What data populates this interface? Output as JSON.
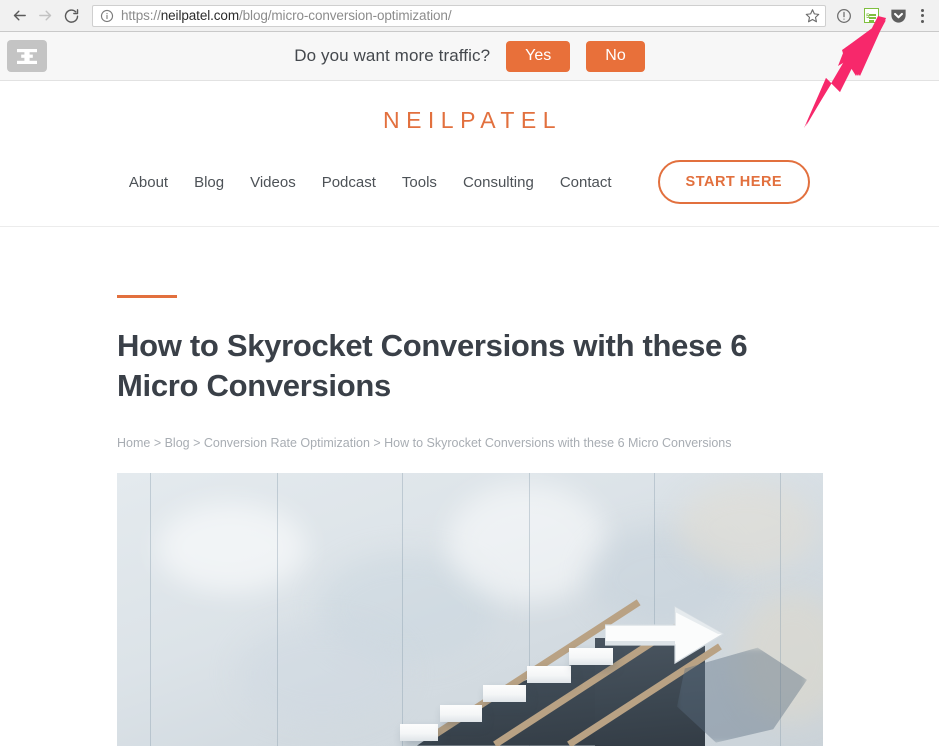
{
  "browser": {
    "back_icon": "back-arrow-icon",
    "forward_icon": "forward-arrow-icon",
    "reload_icon": "reload-icon",
    "security_icon": "info-circle-icon",
    "url_full": "https://neilpatel.com/blog/micro-conversion-optimization/",
    "url_prefix": "https://",
    "url_host": "neilpatel.com",
    "url_path": "/blog/micro-conversion-optimization/",
    "bookmark_icon": "star-icon",
    "extensions": [
      {
        "name": "reader-extension-icon",
        "label": "Reader"
      },
      {
        "name": "pocket-extension-icon",
        "label": "Pocket"
      }
    ],
    "menu_icon": "three-dot-menu-icon"
  },
  "hello_bar": {
    "logo_icon": "hellobar-logo-icon",
    "question": "Do you want more traffic?",
    "yes_label": "Yes",
    "no_label": "No",
    "button_color": "#e8703a",
    "background": "#f7f7f7"
  },
  "site": {
    "brand": "NEILPATEL",
    "brand_color": "#e2703e",
    "nav": [
      {
        "label": "About"
      },
      {
        "label": "Blog"
      },
      {
        "label": "Videos"
      },
      {
        "label": "Podcast"
      },
      {
        "label": "Tools"
      },
      {
        "label": "Consulting"
      },
      {
        "label": "Contact"
      }
    ],
    "cta_label": "START HERE"
  },
  "article": {
    "accent_color": "#e2703e",
    "title": "How to Skyrocket Conversions with these 6 Micro Conversions",
    "breadcrumb": "Home > Blog > Conversion Rate Optimization > How to Skyrocket Conversions with these 6 Micro Conversions",
    "hero_alt": "white floating staircase on concrete wall with arrow at top"
  },
  "annotation": {
    "arrow_color": "#f7286b",
    "points_to": "pocket-extension-icon"
  }
}
